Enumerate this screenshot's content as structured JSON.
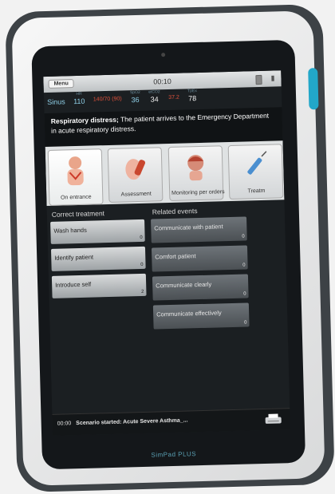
{
  "topbar": {
    "menu_label": "Menu",
    "clock": "00:10"
  },
  "vitals": [
    {
      "label": "",
      "value": "Sinus",
      "tone": "light"
    },
    {
      "label": "HR",
      "value": "110",
      "tone": "light"
    },
    {
      "label": "",
      "value": "140/70 (90)",
      "tone": "red"
    },
    {
      "label": "SpO2",
      "value": "36",
      "tone": "light"
    },
    {
      "label": "etCO2",
      "value": "34",
      "tone": "white"
    },
    {
      "label": "",
      "value": "37.2",
      "tone": "red"
    },
    {
      "label": "TpEx",
      "value": "78",
      "tone": "white"
    }
  ],
  "description": {
    "bold": "Respiratory distress;",
    "text": " The patient arrives to the Emergency Department in acute respiratory distress."
  },
  "tabs": [
    {
      "label": "On entrance",
      "icon": "patient-icon"
    },
    {
      "label": "Assessment",
      "icon": "assessment-icon"
    },
    {
      "label": "Monitoring per orders",
      "icon": "monitoring-icon"
    },
    {
      "label": "Treatm",
      "icon": "treatment-icon"
    }
  ],
  "left_column": {
    "title": "Correct treatment",
    "items": [
      {
        "label": "Wash hands",
        "count": "0"
      },
      {
        "label": "Identify patient",
        "count": "0"
      },
      {
        "label": "Introduce self",
        "count": "2"
      }
    ]
  },
  "right_column": {
    "title": "Related events",
    "items": [
      {
        "label": "Communicate with patient",
        "count": "0"
      },
      {
        "label": "Comfort patient",
        "count": "0"
      },
      {
        "label": "Communicate clearly",
        "count": "0"
      },
      {
        "label": "Communicate effectively",
        "count": "0"
      }
    ]
  },
  "footer": {
    "time": "00:00",
    "prefix": "Scenario started:",
    "text": " Acute Severe Asthma_..."
  },
  "device": {
    "brand": "SimPad PLUS"
  }
}
